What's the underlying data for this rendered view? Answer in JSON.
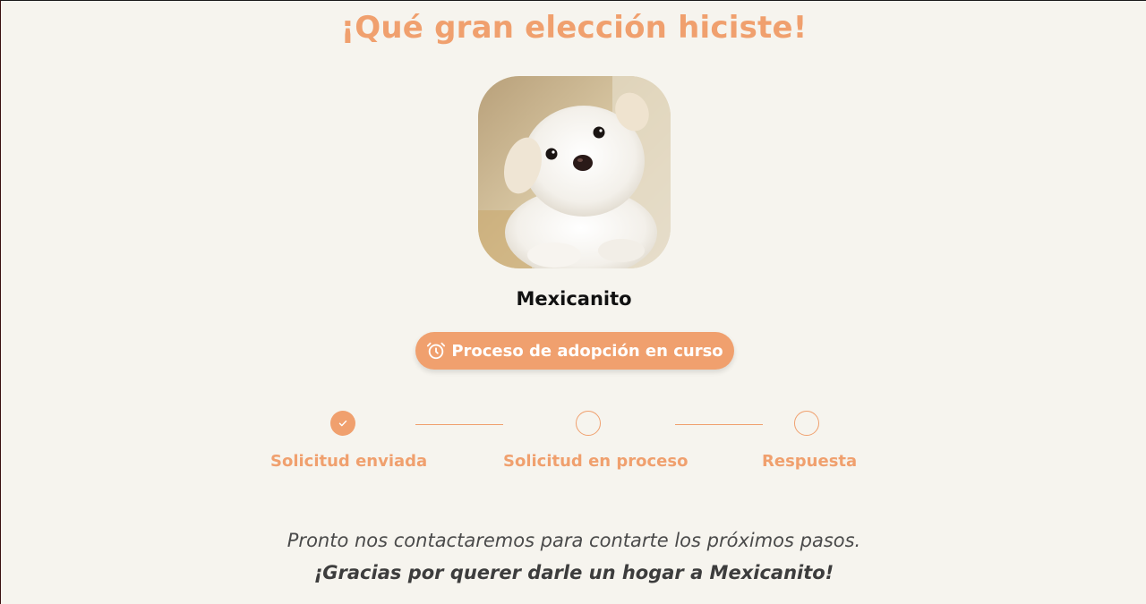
{
  "page": {
    "title": "¡Qué gran elección hiciste!"
  },
  "pet": {
    "name": "Mexicanito",
    "photo_subject": "white-puppy"
  },
  "status": {
    "label": "Proceso de adopción en curso",
    "icon": "alarm-clock-icon"
  },
  "steps": [
    {
      "label": "Solicitud enviada",
      "state": "completed",
      "icon": "check-icon"
    },
    {
      "label": "Solicitud en proceso",
      "state": "pending"
    },
    {
      "label": "Respuesta",
      "state": "pending"
    }
  ],
  "message": {
    "line1": "Pronto nos contactaremos para contarte los próximos pasos.",
    "line2": "¡Gracias por querer darle un hogar a Mexicanito!"
  },
  "colors": {
    "accent": "#f0a06e",
    "background": "#f6f4ee",
    "text_dark": "#111111"
  }
}
